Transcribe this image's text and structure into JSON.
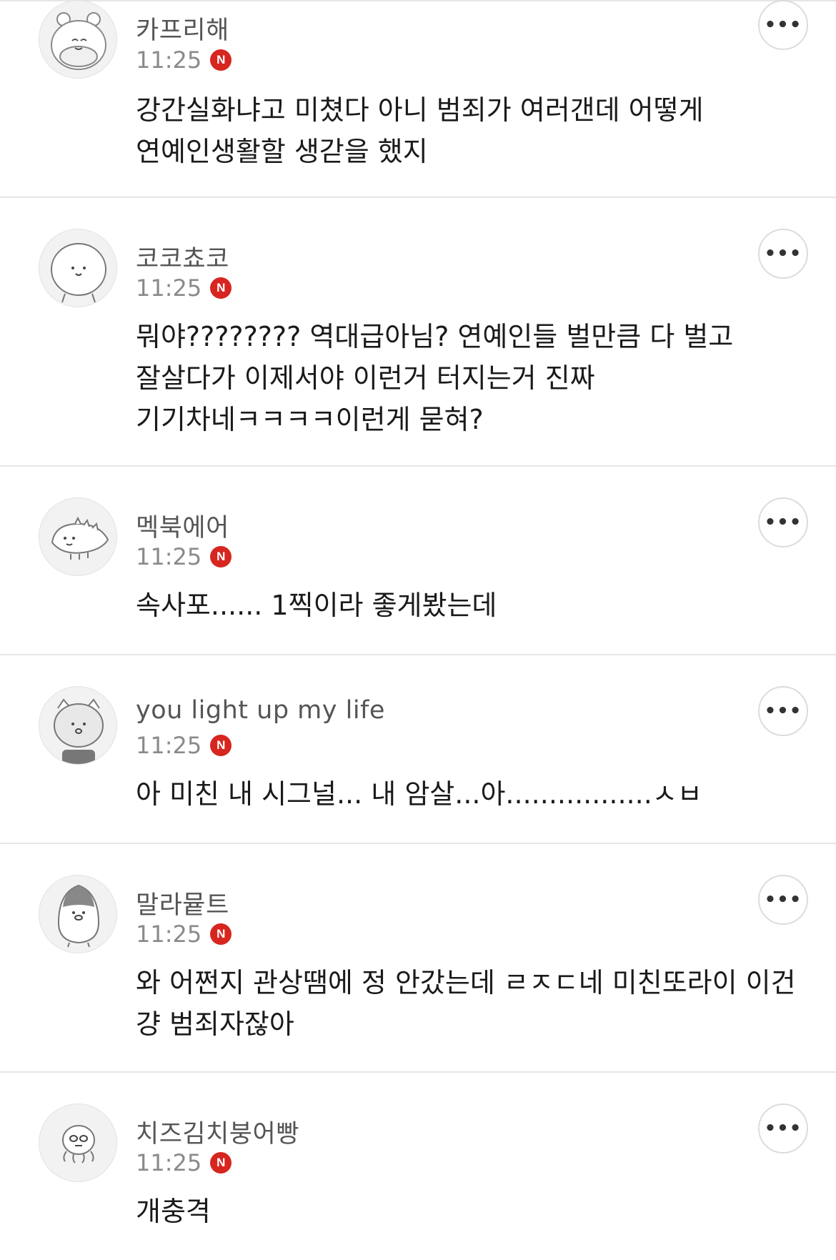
{
  "comments": [
    {
      "nickname": "카프리해",
      "time": "11:25",
      "badge": "N",
      "body": "강간실화냐고 미쳤다 아니 범죄가 여러갠데 어떻게 연예인생활할 생갇을 했지",
      "avatar_icon": "hamster-avatar-icon",
      "more_label": "•••"
    },
    {
      "nickname": "코코쵸코",
      "time": "11:25",
      "badge": "N",
      "body": "뭐야???????? 역대급아님? 연예인들 벌만큼 다 벌고 잘살다가 이제서야 이런거 터지는거 진짜 기기차네ㅋㅋㅋㅋ이런게 묻혀?",
      "avatar_icon": "round-face-avatar-icon",
      "more_label": "•••"
    },
    {
      "nickname": "멕북에어",
      "time": "11:25",
      "badge": "N",
      "body": "속사포...... 1찍이라 좋게봤는데",
      "avatar_icon": "dinosaur-avatar-icon",
      "more_label": "•••"
    },
    {
      "nickname": "you light up my life",
      "time": "11:25",
      "badge": "N",
      "body": "아 미친 내 시그널... 내 암살...아.................ㅅㅂ",
      "avatar_icon": "cat-avatar-icon",
      "more_label": "•••"
    },
    {
      "nickname": "말라뮽트",
      "time": "11:25",
      "badge": "N",
      "body": "와 어쩐지 관상땜에 정 안갔는데 ㄹㅈㄷ네 미친또라이 이건 걍 범죄자잖아",
      "avatar_icon": "penguin-avatar-icon",
      "more_label": "•••"
    },
    {
      "nickname": "치즈김치붕어빵",
      "time": "11:25",
      "badge": "N",
      "body": "개충격",
      "avatar_icon": "octopus-avatar-icon",
      "more_label": "•••"
    }
  ],
  "colors": {
    "badge": "#d6261f",
    "divider": "#e6e6e6",
    "nickname": "#555555",
    "time": "#8a8a8a",
    "body": "#1a1a1a"
  }
}
